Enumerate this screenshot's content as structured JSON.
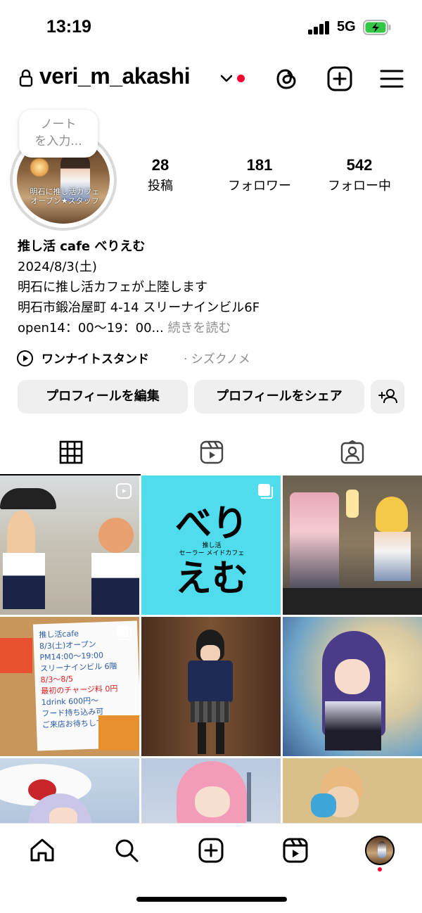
{
  "status_bar": {
    "time": "13:19",
    "network": "5G"
  },
  "header": {
    "username": "veri_m_akashi"
  },
  "note": {
    "placeholder_line1": "ノート",
    "placeholder_line2": "を入力..."
  },
  "avatar": {
    "overlay_text_line1": "明石に推し活カフェ",
    "overlay_text_line2": "オープン★スタッフ"
  },
  "stats": [
    {
      "value": "28",
      "label": "投稿"
    },
    {
      "value": "181",
      "label": "フォロワー"
    },
    {
      "value": "542",
      "label": "フォロー中"
    }
  ],
  "bio": {
    "name": "推し活 cafe べりえむ",
    "lines": [
      "2024/8/3(土)",
      "明石に推し活カフェが上陸します",
      "明石市鍛冶屋町 4-14 スリーナインビル6F",
      "open14：00～19：00..."
    ],
    "more_label": "続きを読む"
  },
  "music": {
    "song": "ワンナイトスタンド",
    "separator_artist": "· シズクノメ"
  },
  "buttons": {
    "edit_profile": "プロフィールを編集",
    "share_profile": "プロフィールをシェア"
  },
  "grid": {
    "logo_big_line1": "べり",
    "logo_big_line2": "えむ",
    "logo_small_line1": "推し活",
    "logo_small_line2": "セーラー メイドカフェ",
    "notice_lines": [
      "推し活cafe",
      "8/3(土)オープン",
      "PM14:00〜19:00",
      "スリーナインビル 6階",
      "8/3〜8/5",
      "最初のチャージ料 0円",
      "1drink 600円〜",
      "フード持ち込み可",
      "ご来店お待ちしております"
    ]
  },
  "colors": {
    "accent_red": "#ff0033",
    "button_bg": "#efefef",
    "muted_text": "#8e8e8e",
    "logo_bg": "#4fdcec"
  }
}
